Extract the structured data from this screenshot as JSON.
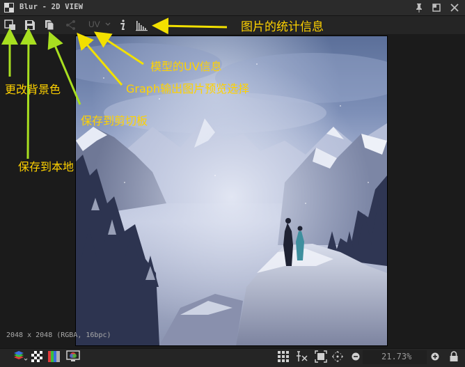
{
  "window": {
    "title": "Blur - 2D VIEW"
  },
  "toolbar": {
    "uv_label": "UV"
  },
  "annotations": {
    "bg_color": "更改背景色",
    "save_local": "保存到本地",
    "clipboard": "保存到剪切板",
    "graph_preview": "Graph输出图片预览选择",
    "uv_info": "模型的UV信息",
    "stats": "图片的统计信息"
  },
  "image_info": "2048 x 2048 (RGBA, 16bpc)",
  "status": {
    "zoom": "21.73%"
  },
  "colors": {
    "annotation": "#ffd200",
    "arrow": "#f2e000",
    "arrow_green": "#a8df20",
    "panel": "#252525",
    "background": "#1b1b1b"
  },
  "icons": [
    "window-icon",
    "pin-icon",
    "maximize-icon",
    "close-icon",
    "background-color-icon",
    "save-icon",
    "copy-clipboard-icon",
    "graph-output-icon",
    "chevron-down-icon",
    "info-icon",
    "histogram-icon",
    "layers-icon",
    "transparency-checker-icon",
    "color-channels-icon",
    "display-icon",
    "grid-tiling-icon",
    "pixel-picker-icon",
    "fit-view-icon",
    "pan-icon",
    "zoom-out-icon",
    "zoom-in-icon",
    "lock-icon"
  ]
}
